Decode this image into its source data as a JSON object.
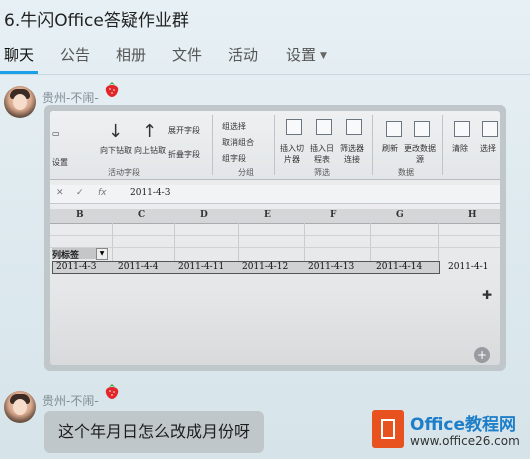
{
  "header": {
    "title": "6.牛闪Office答疑作业群",
    "tabs": [
      {
        "label": "聊天",
        "active": true
      },
      {
        "label": "公告"
      },
      {
        "label": "相册"
      },
      {
        "label": "文件"
      },
      {
        "label": "活动"
      },
      {
        "label": "设置",
        "has_dropdown": true
      }
    ]
  },
  "messages": [
    {
      "sender": "贵州-不闹-",
      "badge_icon": "strawberry-icon",
      "type": "image"
    },
    {
      "sender": "贵州-不闹-",
      "badge_icon": "strawberry-icon",
      "type": "text",
      "text": "这个年月日怎么改成月份呀"
    }
  ],
  "screenshot_photo": {
    "ribbon": {
      "buttons": [
        "向下钻取",
        "向上钻取",
        "展开字段",
        "折叠字段",
        "组选择",
        "取消组合",
        "组字段",
        "插入切片器",
        "插入日程表",
        "筛选器连接",
        "刷新",
        "更改数据源",
        "清除",
        "选择"
      ],
      "groups": [
        "活动字段",
        "分组",
        "筛选",
        "数据"
      ],
      "partial_left_text": "设置"
    },
    "formula_bar": {
      "value": "2011-4-3",
      "fx_label": "fx"
    },
    "columns": [
      "B",
      "C",
      "D",
      "E",
      "F",
      "G",
      "H"
    ],
    "pivot": {
      "label": "列标签",
      "dates": [
        "2011-4-3",
        "2011-4-4",
        "2011-4-11",
        "2011-4-12",
        "2011-4-13",
        "2011-4-14",
        "2011-4-1"
      ]
    }
  },
  "watermark": {
    "title": "Office教程网",
    "url": "www.office26.com",
    "brand_color": "#e8521f",
    "text_color": "#1f7ec8"
  },
  "colors": {
    "accent": "#1aa0e8",
    "bubble": "#c0c7cb"
  }
}
